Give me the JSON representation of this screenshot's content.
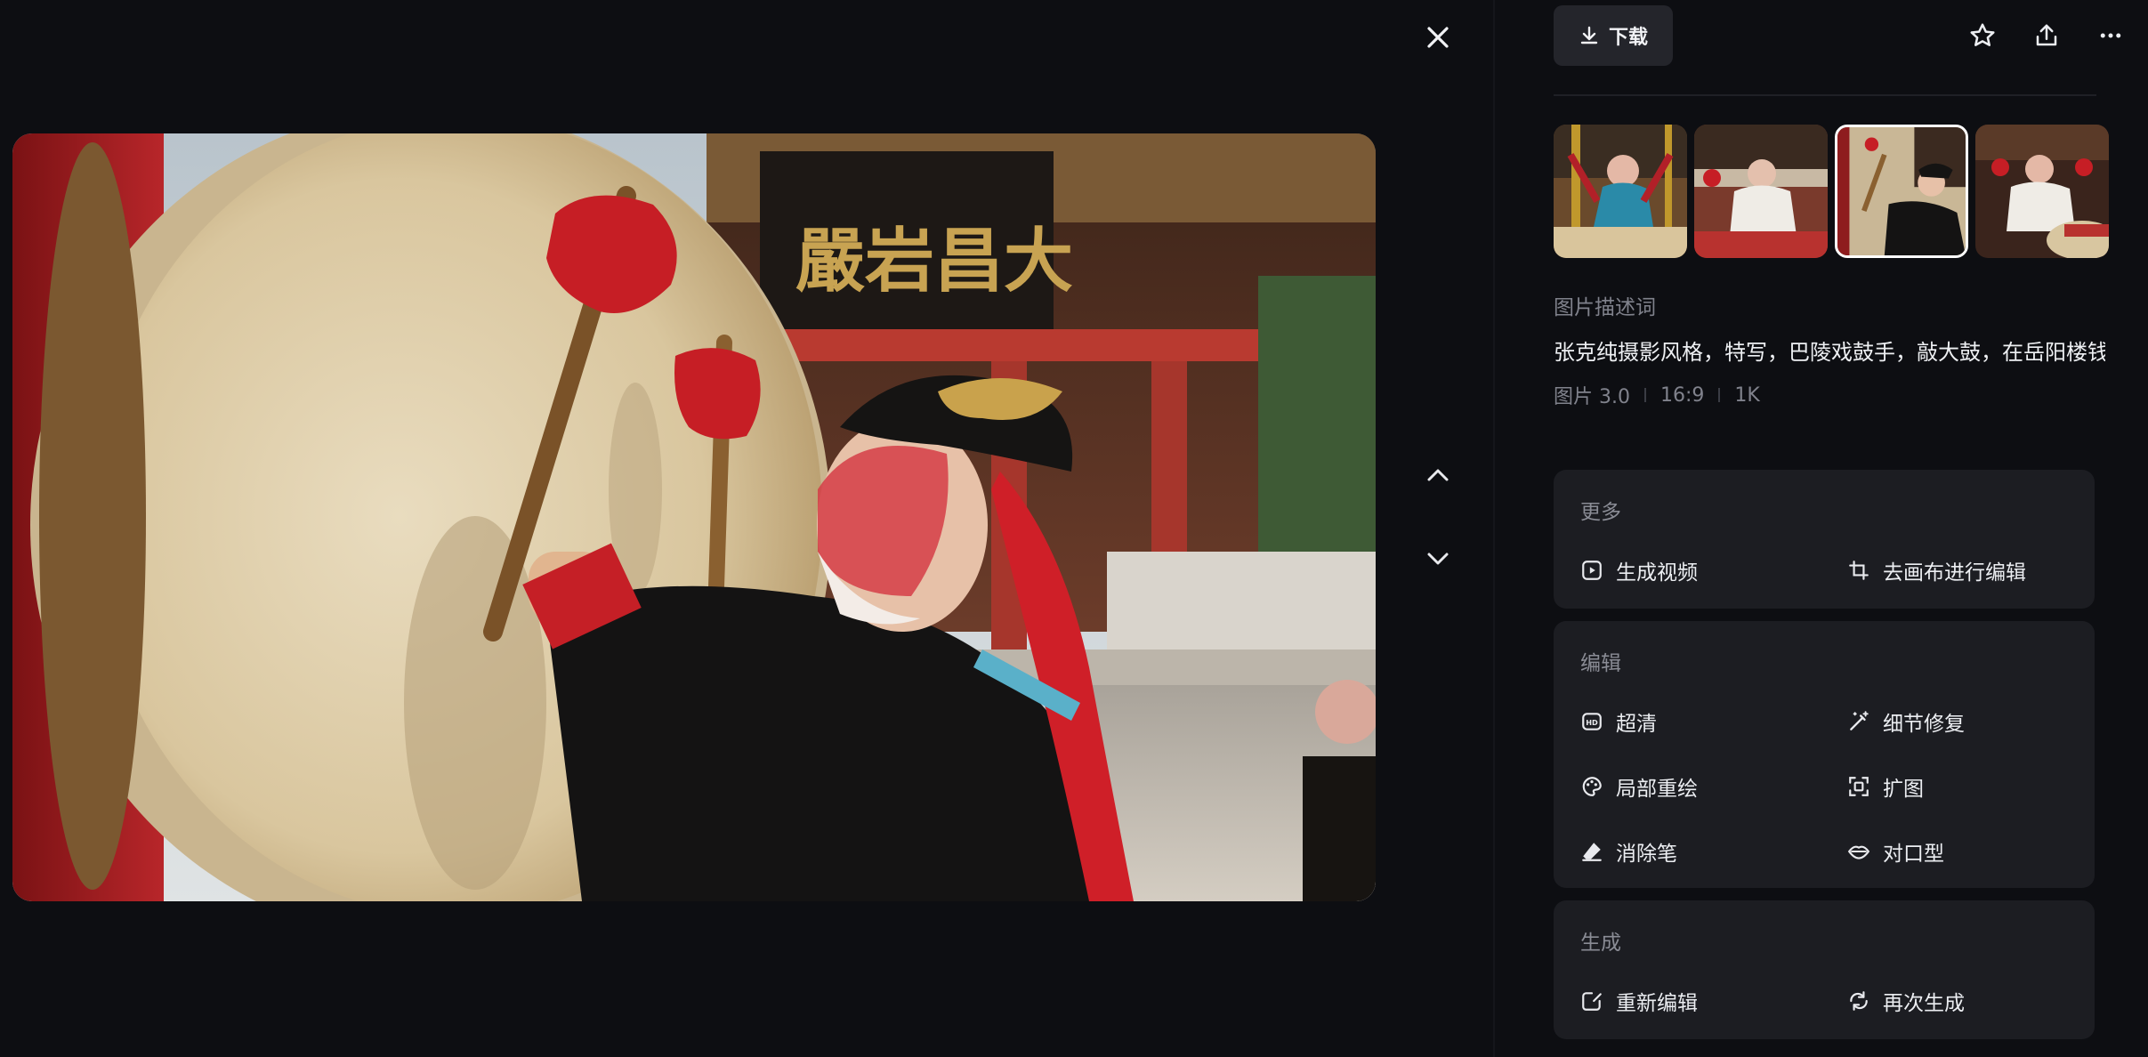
{
  "viewer": {
    "close_icon": "close-icon",
    "prev_icon": "chevron-up-icon",
    "next_icon": "chevron-down-icon"
  },
  "toolbar": {
    "download_label": "下载",
    "icons": [
      "download-icon",
      "star-icon",
      "share-icon",
      "more-icon"
    ]
  },
  "thumbnails": [
    {
      "index": 1,
      "selected": false
    },
    {
      "index": 2,
      "selected": false
    },
    {
      "index": 3,
      "selected": true
    },
    {
      "index": 4,
      "selected": false
    }
  ],
  "description": {
    "label": "图片描述词",
    "text": "张克纯摄影风格，特写，巴陵戏鼓手，敲大鼓，在岳阳楼钱",
    "model": "图片 3.0",
    "ratio": "16:9",
    "resolution": "1K"
  },
  "sections": {
    "more": {
      "title": "更多",
      "items": [
        {
          "label": "生成视频",
          "icon": "play-video-icon"
        },
        {
          "label": "去画布进行编辑",
          "icon": "crop-canvas-icon"
        }
      ]
    },
    "edit": {
      "title": "编辑",
      "items": [
        {
          "label": "超清",
          "icon": "hd-icon"
        },
        {
          "label": "细节修复",
          "icon": "magic-wand-icon"
        },
        {
          "label": "局部重绘",
          "icon": "palette-icon"
        },
        {
          "label": "扩图",
          "icon": "expand-icon"
        },
        {
          "label": "消除笔",
          "icon": "eraser-icon"
        },
        {
          "label": "对口型",
          "icon": "lips-icon"
        }
      ]
    },
    "generate": {
      "title": "生成",
      "items": [
        {
          "label": "重新编辑",
          "icon": "edit-icon"
        },
        {
          "label": "再次生成",
          "icon": "regenerate-icon"
        }
      ]
    }
  },
  "colors": {
    "background": "#0d0e12",
    "card": "#1c1d22",
    "muted_text": "#80828c",
    "accent_red": "#c8202a"
  }
}
